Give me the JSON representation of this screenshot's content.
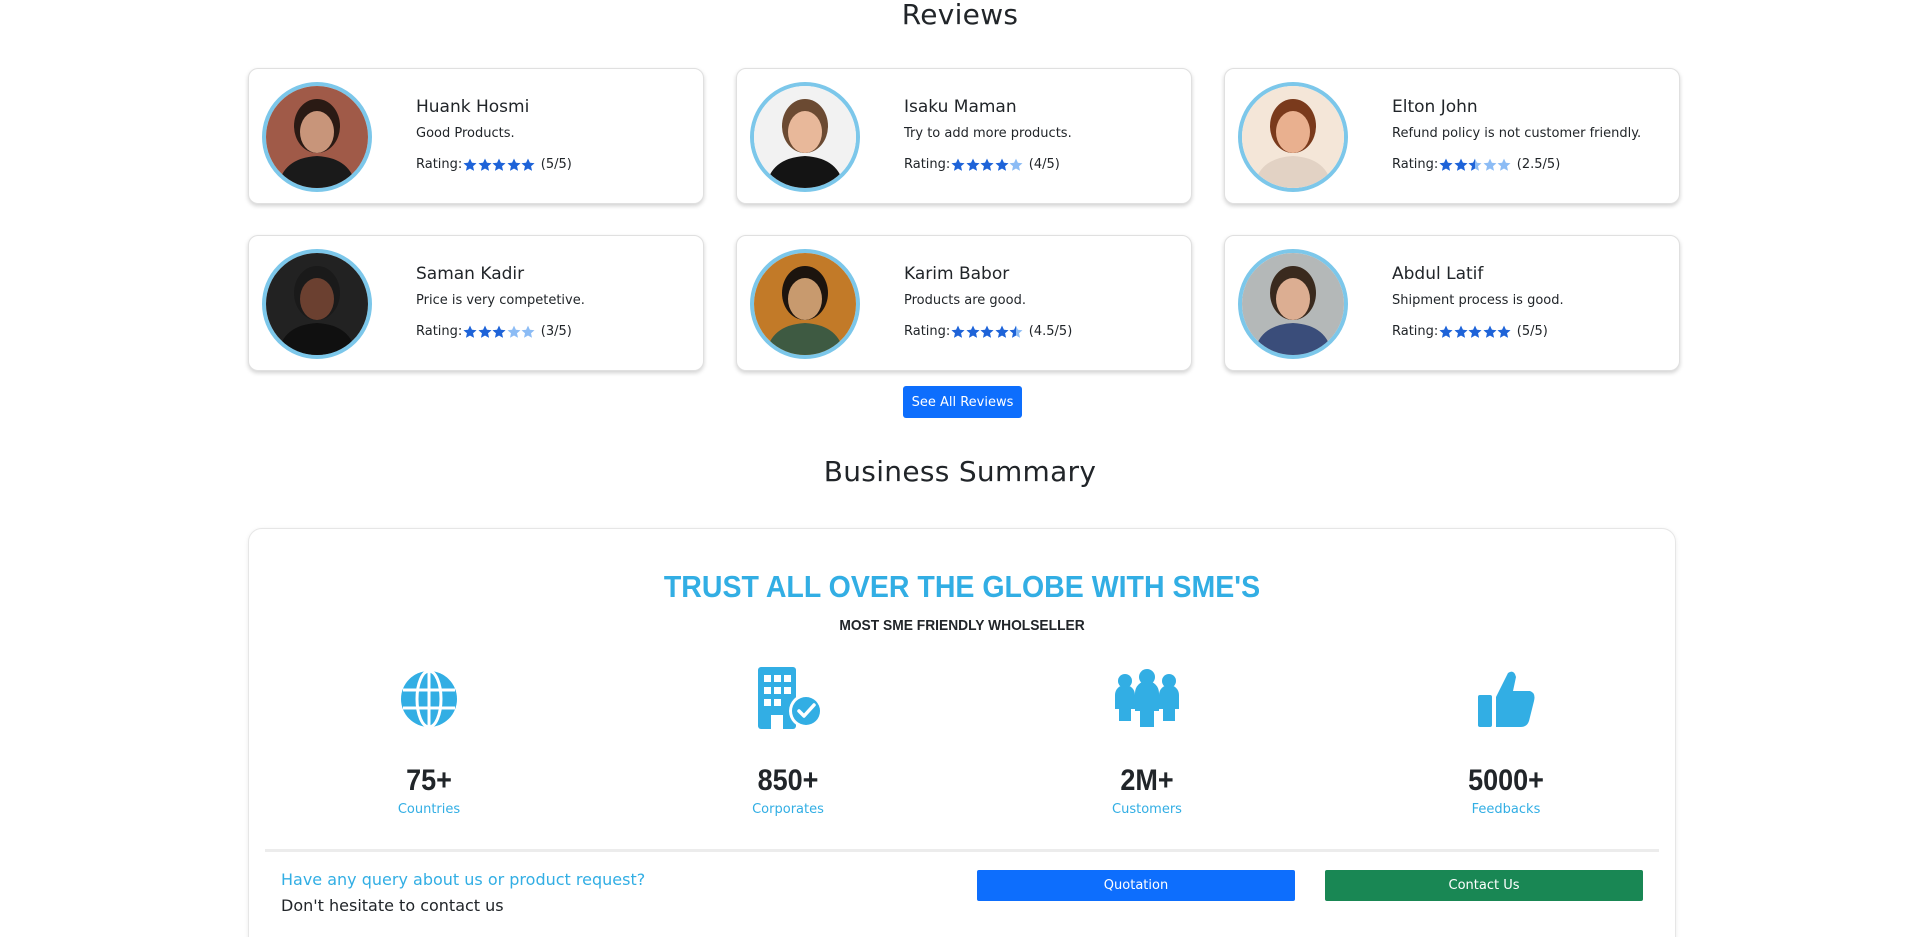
{
  "reviews": {
    "title": "Reviews",
    "rating_label": "Rating:",
    "see_all_label": "See All Reviews",
    "items": [
      {
        "name": "Huank Hosmi",
        "comment": "Good Products.",
        "rating": 5,
        "rating_text": "(5/5)"
      },
      {
        "name": "Isaku Maman",
        "comment": "Try to add more products.",
        "rating": 4,
        "rating_text": "(4/5)"
      },
      {
        "name": "Elton John",
        "comment": "Refund policy is not customer friendly.",
        "rating": 2.5,
        "rating_text": "(2.5/5)"
      },
      {
        "name": "Saman Kadir",
        "comment": "Price is very competetive.",
        "rating": 3,
        "rating_text": "(3/5)"
      },
      {
        "name": "Karim Babor",
        "comment": "Products are good.",
        "rating": 4.5,
        "rating_text": "(4.5/5)"
      },
      {
        "name": "Abdul Latif",
        "comment": "Shipment process is good.",
        "rating": 5,
        "rating_text": "(5/5)"
      }
    ]
  },
  "summary": {
    "title": "Business Summary",
    "headline": "TRUST ALL OVER THE GLOBE WITH SME'S",
    "subheadline": "MOST SME FRIENDLY WHOLSELLER",
    "stats": [
      {
        "icon": "globe-icon",
        "value": "75+",
        "label": "Countries"
      },
      {
        "icon": "building-check-icon",
        "value": "850+",
        "label": "Corporates"
      },
      {
        "icon": "people-group-icon",
        "value": "2M+",
        "label": "Customers"
      },
      {
        "icon": "thumbs-up-icon",
        "value": "5000+",
        "label": "Feedbacks"
      }
    ],
    "contact": {
      "question": "Have any query about us or product request?",
      "subtext": "Don't hesitate to contact us",
      "quotation_label": "Quotation",
      "contact_label": "Contact Us"
    }
  },
  "colors": {
    "accent": "#32aee4",
    "primary": "#0d6efd",
    "success": "#198754",
    "star_filled": "#1e63d8",
    "star_empty": "#8cbcf5",
    "avatar_ring": "#7cc7ea"
  }
}
